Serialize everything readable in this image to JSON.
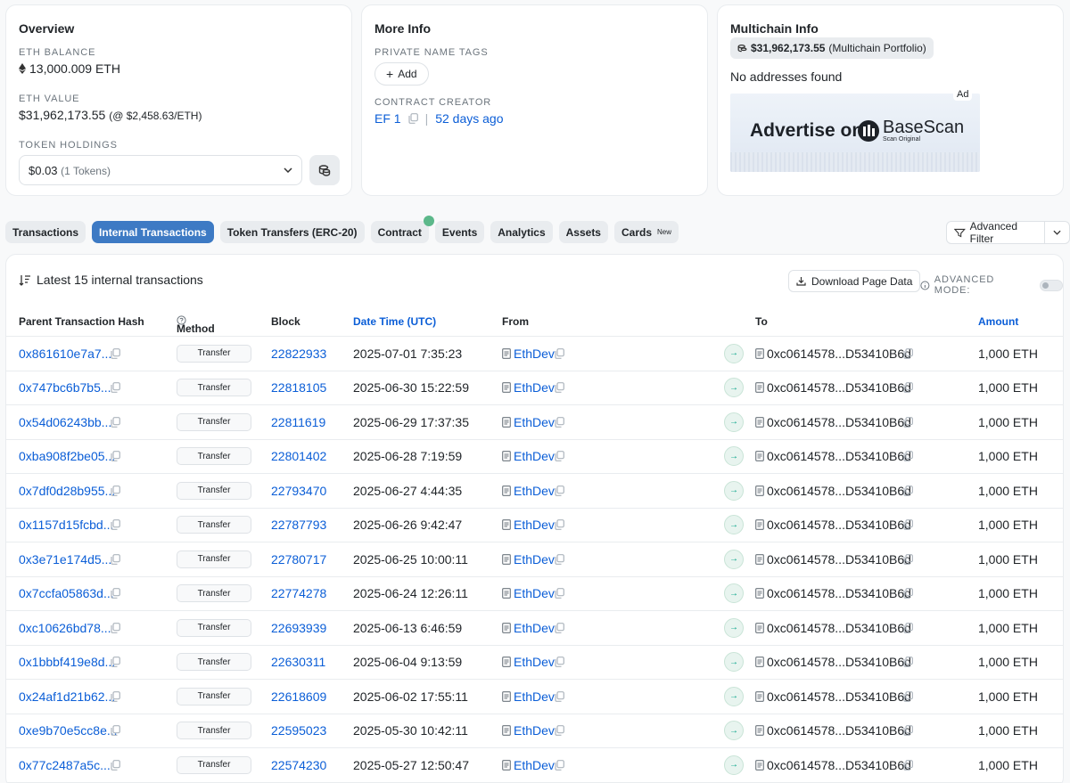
{
  "overview": {
    "title": "Overview",
    "eth_balance_label": "ETH BALANCE",
    "eth_balance": "13,000.009 ETH",
    "eth_value_label": "ETH VALUE",
    "eth_value": "$31,962,173.55",
    "eth_price": "(@ $2,458.63/ETH)",
    "token_holdings_label": "TOKEN HOLDINGS",
    "token_value": "$0.03",
    "token_count": "(1 Tokens)"
  },
  "more_info": {
    "title": "More Info",
    "private_tags_label": "PRIVATE NAME TAGS",
    "add_label": "Add",
    "creator_label": "CONTRACT CREATOR",
    "creator": "EF 1",
    "separator": "|",
    "created_ago": "52 days ago"
  },
  "multichain": {
    "title": "Multichain Info",
    "portfolio_value": "$31,962,173.55",
    "portfolio_label": "(Multichain Portfolio)",
    "no_addresses": "No addresses found",
    "ad_tag": "Ad",
    "ad_text": "Advertise on",
    "ad_brand": "BaseScan",
    "ad_brand_sub": "Scan Original"
  },
  "tabs": [
    {
      "label": "Transactions",
      "active": false
    },
    {
      "label": "Internal Transactions",
      "active": true
    },
    {
      "label": "Token Transfers (ERC-20)",
      "active": false
    },
    {
      "label": "Contract",
      "active": false
    },
    {
      "label": "Events",
      "active": false
    },
    {
      "label": "Analytics",
      "active": false
    },
    {
      "label": "Assets",
      "active": false
    },
    {
      "label": "Cards",
      "active": false,
      "badge": "New"
    }
  ],
  "advanced_filter_label": "Advanced Filter",
  "table": {
    "title": "Latest 15 internal transactions",
    "download_label": "Download Page Data",
    "advanced_mode_label": "ADVANCED MODE:",
    "headers": {
      "hash": "Parent Transaction Hash",
      "method": "Method",
      "block": "Block",
      "date": "Date Time (UTC)",
      "from": "From",
      "to": "To",
      "amount": "Amount"
    },
    "rows": [
      {
        "hash": "0x861610e7a7...",
        "method": "Transfer",
        "block": "22822933",
        "date": "2025-07-01 7:35:23",
        "from": "EthDev",
        "to": "0xc0614578...D53410B6d",
        "amount": "1,000 ETH"
      },
      {
        "hash": "0x747bc6b7b5...",
        "method": "Transfer",
        "block": "22818105",
        "date": "2025-06-30 15:22:59",
        "from": "EthDev",
        "to": "0xc0614578...D53410B6d",
        "amount": "1,000 ETH"
      },
      {
        "hash": "0x54d06243bb...",
        "method": "Transfer",
        "block": "22811619",
        "date": "2025-06-29 17:37:35",
        "from": "EthDev",
        "to": "0xc0614578...D53410B6d",
        "amount": "1,000 ETH"
      },
      {
        "hash": "0xba908f2be05...",
        "method": "Transfer",
        "block": "22801402",
        "date": "2025-06-28 7:19:59",
        "from": "EthDev",
        "to": "0xc0614578...D53410B6d",
        "amount": "1,000 ETH"
      },
      {
        "hash": "0x7df0d28b955...",
        "method": "Transfer",
        "block": "22793470",
        "date": "2025-06-27 4:44:35",
        "from": "EthDev",
        "to": "0xc0614578...D53410B6d",
        "amount": "1,000 ETH"
      },
      {
        "hash": "0x1157d15fcbd...",
        "method": "Transfer",
        "block": "22787793",
        "date": "2025-06-26 9:42:47",
        "from": "EthDev",
        "to": "0xc0614578...D53410B6d",
        "amount": "1,000 ETH"
      },
      {
        "hash": "0x3e71e174d5...",
        "method": "Transfer",
        "block": "22780717",
        "date": "2025-06-25 10:00:11",
        "from": "EthDev",
        "to": "0xc0614578...D53410B6d",
        "amount": "1,000 ETH"
      },
      {
        "hash": "0x7ccfa05863d...",
        "method": "Transfer",
        "block": "22774278",
        "date": "2025-06-24 12:26:11",
        "from": "EthDev",
        "to": "0xc0614578...D53410B6d",
        "amount": "1,000 ETH"
      },
      {
        "hash": "0xc10626bd78...",
        "method": "Transfer",
        "block": "22693939",
        "date": "2025-06-13 6:46:59",
        "from": "EthDev",
        "to": "0xc0614578...D53410B6d",
        "amount": "1,000 ETH"
      },
      {
        "hash": "0x1bbbf419e8d...",
        "method": "Transfer",
        "block": "22630311",
        "date": "2025-06-04 9:13:59",
        "from": "EthDev",
        "to": "0xc0614578...D53410B6d",
        "amount": "1,000 ETH"
      },
      {
        "hash": "0x24af1d21b62...",
        "method": "Transfer",
        "block": "22618609",
        "date": "2025-06-02 17:55:11",
        "from": "EthDev",
        "to": "0xc0614578...D53410B6d",
        "amount": "1,000 ETH"
      },
      {
        "hash": "0xe9b70e5cc8e...",
        "method": "Transfer",
        "block": "22595023",
        "date": "2025-05-30 10:42:11",
        "from": "EthDev",
        "to": "0xc0614578...D53410B6d",
        "amount": "1,000 ETH"
      },
      {
        "hash": "0x77c2487a5c...",
        "method": "Transfer",
        "block": "22574230",
        "date": "2025-05-27 12:50:47",
        "from": "EthDev",
        "to": "0xc0614578...D53410B6d",
        "amount": "1,000 ETH"
      }
    ]
  },
  "colors": {
    "link": "#0b5ed7",
    "active_tab": "#3d7ac4",
    "arrow_green": "#00a186"
  }
}
